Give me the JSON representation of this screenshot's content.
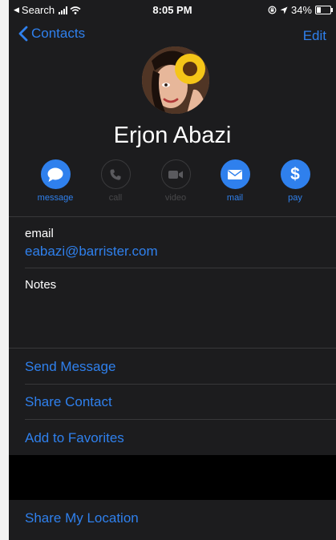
{
  "status_bar": {
    "back_app": "Search",
    "time": "8:05 PM",
    "battery_percent": "34%",
    "battery_level": 0.34
  },
  "nav": {
    "back_label": "Contacts",
    "edit_label": "Edit"
  },
  "contact": {
    "name": "Erjon Abazi"
  },
  "actions": [
    {
      "label": "message",
      "enabled": true,
      "icon": "message-icon"
    },
    {
      "label": "call",
      "enabled": false,
      "icon": "phone-icon"
    },
    {
      "label": "video",
      "enabled": false,
      "icon": "video-camera-icon"
    },
    {
      "label": "mail",
      "enabled": true,
      "icon": "mail-icon"
    },
    {
      "label": "pay",
      "enabled": true,
      "icon": "dollar-icon"
    }
  ],
  "email": {
    "label": "email",
    "value": "eabazi@barrister.com"
  },
  "notes": {
    "label": "Notes"
  },
  "options": {
    "send_message": "Send Message",
    "share_contact": "Share Contact",
    "add_favorites": "Add to Favorites",
    "share_location": "Share My Location"
  },
  "colors": {
    "accent": "#2f80ed",
    "background": "#1c1c1e"
  }
}
